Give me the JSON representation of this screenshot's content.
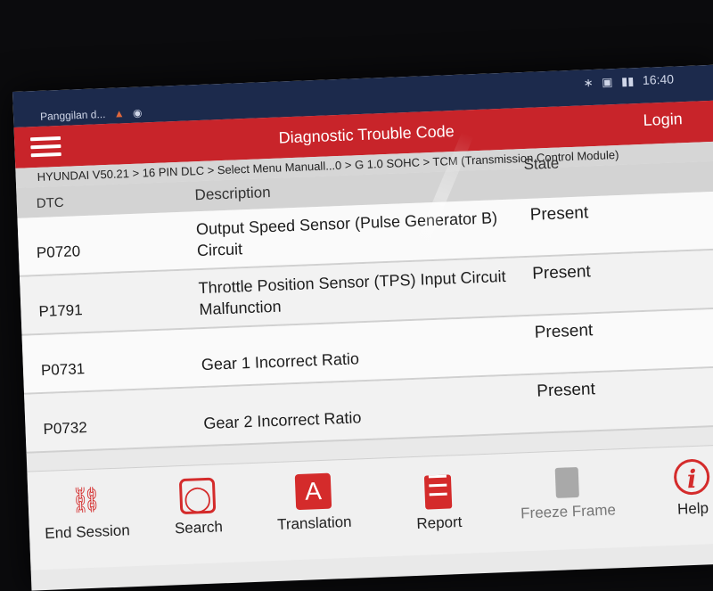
{
  "status_bar": {
    "notification_text": "Panggilan d...",
    "notification_icons": [
      "alert-icon",
      "location-icon"
    ],
    "icons": [
      "bluetooth-icon",
      "sim-icon",
      "battery-icon"
    ],
    "time": "16:40"
  },
  "header": {
    "title": "Diagnostic Trouble Code",
    "login_label": "Login"
  },
  "breadcrumb": "HYUNDAI V50.21 > 16 PIN DLC > Select Menu Manuall...0 > G 1.0 SOHC > TCM (Transmission Control Module)",
  "table": {
    "columns": [
      "DTC",
      "Description",
      "State"
    ],
    "rows": [
      {
        "dtc": "P0720",
        "description_line1": "Output Speed Sensor (Pulse Generator B)",
        "description_line2": "Circuit",
        "state": "Present"
      },
      {
        "dtc": "P1791",
        "description_line1": "Throttle Position Sensor (TPS) Input Circuit",
        "description_line2": "Malfunction",
        "state": "Present"
      },
      {
        "dtc": "P0731",
        "description_line1": "Gear 1 Incorrect Ratio",
        "description_line2": "",
        "state": "Present"
      },
      {
        "dtc": "P0732",
        "description_line1": "Gear 2 Incorrect Ratio",
        "description_line2": "",
        "state": "Present"
      }
    ]
  },
  "toolbar": {
    "items": [
      {
        "label": "End Session",
        "icon": "car-icon",
        "enabled": true
      },
      {
        "label": "Search",
        "icon": "search-icon",
        "enabled": true
      },
      {
        "label": "Translation",
        "icon": "translate-icon",
        "enabled": true
      },
      {
        "label": "Report",
        "icon": "report-icon",
        "enabled": true
      },
      {
        "label": "Freeze Frame",
        "icon": "freeze-frame-icon",
        "enabled": false
      },
      {
        "label": "Help",
        "icon": "info-icon",
        "enabled": true
      }
    ]
  },
  "colors": {
    "accent": "#c8242a",
    "status_bar": "#1c2a4c",
    "disabled": "#9d9d9d"
  }
}
